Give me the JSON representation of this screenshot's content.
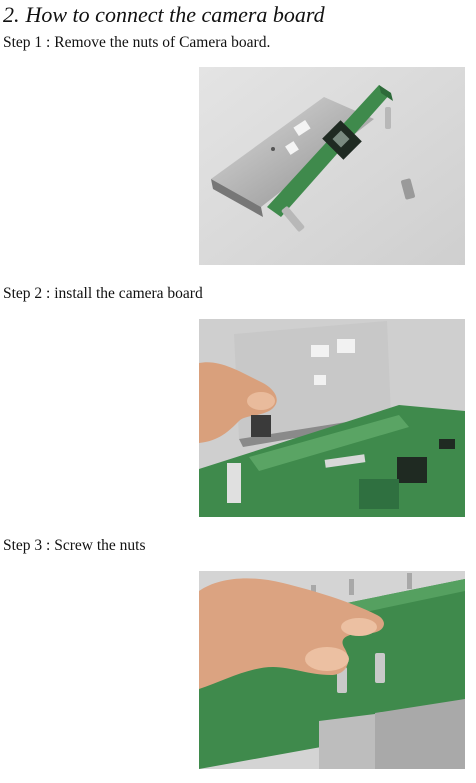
{
  "section": {
    "number": "2.",
    "title": "How to connect the camera board"
  },
  "steps": [
    {
      "label": "Step 1 : Remove the nuts of Camera board."
    },
    {
      "label": "Step 2 : install the camera board"
    },
    {
      "label": "Step 3 : Screw the nuts"
    }
  ]
}
